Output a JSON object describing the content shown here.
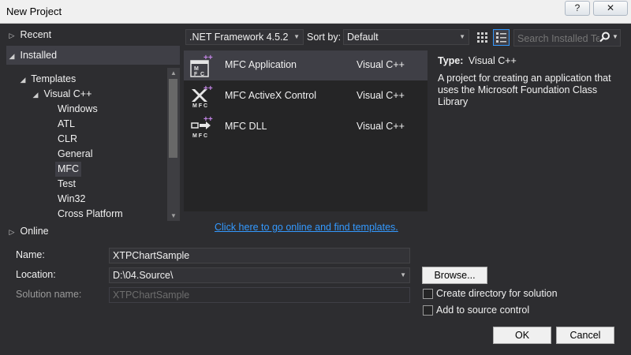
{
  "window": {
    "title": "New Project",
    "help_button": "?",
    "close_button": "✕"
  },
  "left_panel": {
    "recent": "Recent",
    "installed": "Installed",
    "online": "Online",
    "tree": {
      "templates": "Templates",
      "visual_cpp": "Visual C++",
      "children": [
        "Windows",
        "ATL",
        "CLR",
        "General",
        "MFC",
        "Test",
        "Win32",
        "Cross Platform"
      ],
      "selected": "MFC"
    }
  },
  "toolbar": {
    "framework": ".NET Framework 4.5.2",
    "sort_by_label": "Sort by:",
    "sort_by_value": "Default",
    "search_placeholder": "Search Installed Te"
  },
  "templates": [
    {
      "name": "MFC Application",
      "language": "Visual C++",
      "icon": "mfc-application-icon",
      "selected": true
    },
    {
      "name": "MFC ActiveX Control",
      "language": "Visual C++",
      "icon": "mfc-activex-icon",
      "selected": false
    },
    {
      "name": "MFC DLL",
      "language": "Visual C++",
      "icon": "mfc-dll-icon",
      "selected": false
    }
  ],
  "description": {
    "type_label": "Type:",
    "type_value": "Visual C++",
    "line1": "A project for creating an application that",
    "line2": "uses the Microsoft Foundation Class",
    "line3": "Library"
  },
  "online_link": "Click here to go online and find templates.",
  "form": {
    "name_label": "Name:",
    "name_value": "XTPChartSample",
    "location_label": "Location:",
    "location_value": "D:\\04.Source\\",
    "solution_label": "Solution name:",
    "solution_value": "XTPChartSample",
    "browse": "Browse...",
    "create_dir": "Create directory for solution",
    "add_source": "Add to source control",
    "ok": "OK",
    "cancel": "Cancel"
  },
  "colors": {
    "background": "#2d2d30",
    "list_background": "#252526",
    "selected": "#3f3f46",
    "link": "#3399ff",
    "accent": "#3399ff"
  }
}
